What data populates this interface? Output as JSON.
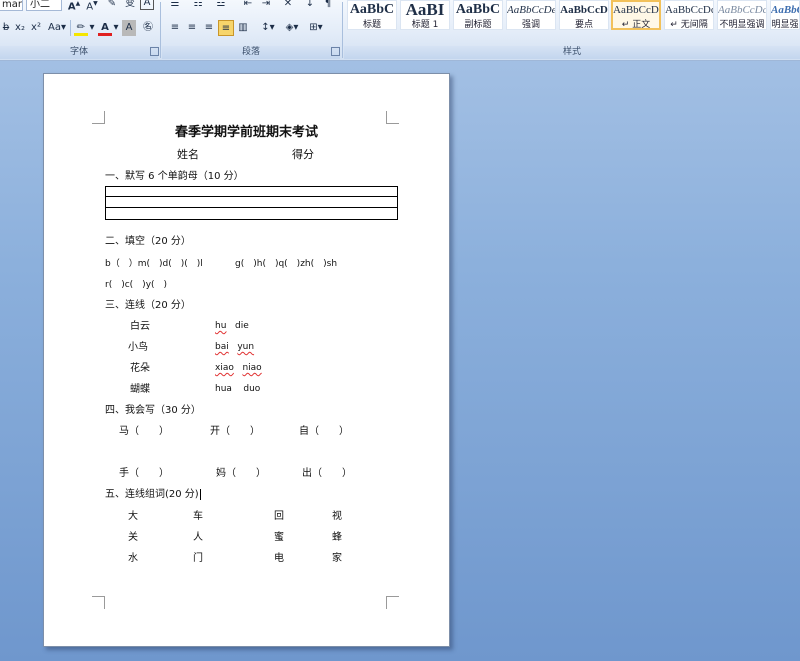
{
  "ribbon": {
    "font_combo": "mar",
    "size_combo": "小二",
    "group_font": "字体",
    "group_paragraph": "段落",
    "group_styles": "样式",
    "styles": [
      {
        "preview": "AaBbC",
        "name": "标题"
      },
      {
        "preview": "AaBI",
        "name": "标题 1"
      },
      {
        "preview": "AaBbC",
        "name": "副标题"
      },
      {
        "preview": "AaBbCcDe",
        "name": "强调"
      },
      {
        "preview": "AaBbCcD",
        "name": "要点"
      },
      {
        "preview": "AaBbCcDc",
        "name": "↵ 正文"
      },
      {
        "preview": "AaBbCcDc",
        "name": "↵ 无间隔"
      },
      {
        "preview": "AaBbCcDc",
        "name": "不明显强调"
      },
      {
        "preview": "AaBbCcDc",
        "name": "明显强"
      }
    ],
    "font_color": "#e02020",
    "highlight_color": "#f5e600"
  },
  "doc": {
    "title": "春季学期学前班期末考试",
    "name_label": "姓名",
    "score_label": "得分",
    "s1": "一、默写 6 个单韵母（10 分）",
    "s2": "二、填空（20 分）",
    "s2_line1": [
      "b（　）m(　)d(　)(　)l",
      "g(　)h(　)q(　)zh(　)sh"
    ],
    "s2_line2": "r(　)c(　)y(　)",
    "s3": "三、连线（20 分）",
    "s3_left": [
      "白云",
      "小鸟",
      "花朵",
      "蝴蝶"
    ],
    "s3_right": [
      [
        "hu",
        "die"
      ],
      [
        "bai",
        "yun"
      ],
      [
        "xiao",
        "niao"
      ],
      [
        "hua",
        "duo"
      ]
    ],
    "s4": "四、我会写（30 分）",
    "s4_row1": [
      "马（　　）",
      "开（　　）",
      "自（　　）"
    ],
    "s4_row2": [
      "手（　　）",
      "妈（　　）",
      "出（　　）"
    ],
    "s5": "五、连线组词(20 分)",
    "s5_rows": [
      [
        "大",
        "车",
        "回",
        "视"
      ],
      [
        "关",
        "人",
        "蜜",
        "蜂"
      ],
      [
        "水",
        "门",
        "电",
        "家"
      ]
    ]
  }
}
